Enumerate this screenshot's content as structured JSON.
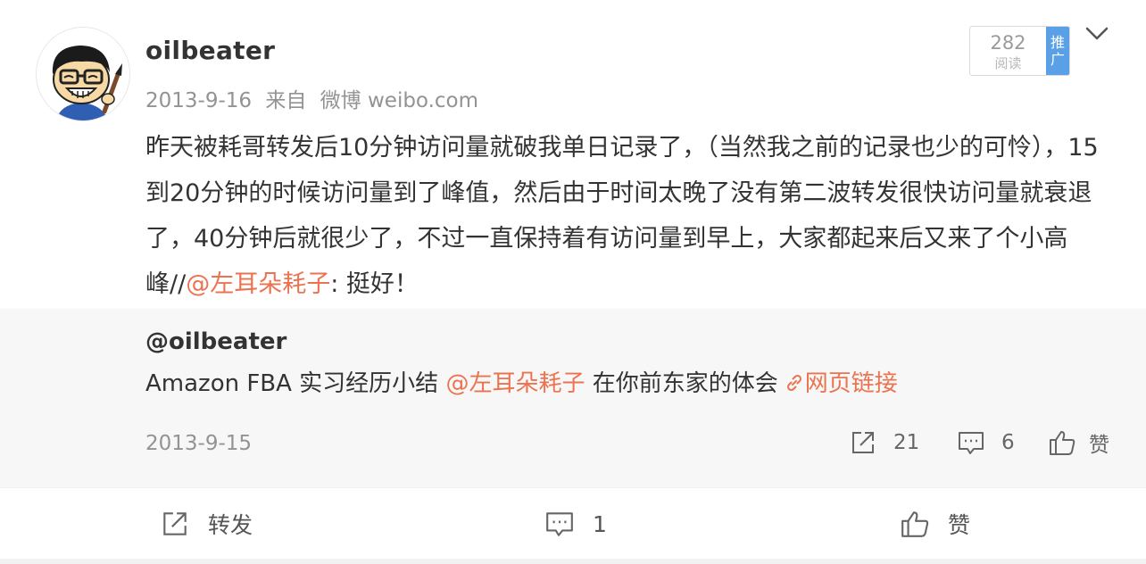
{
  "post": {
    "username": "oilbeater",
    "date": "2013-9-16",
    "source_prefix": "来自",
    "source": "微博 weibo.com",
    "text_before": "昨天被耗哥转发后10分钟访问量就破我单日记录了，（当然我之前的记录也少的可怜），15到20分钟的时候访问量到了峰值，然后由于时间太晚了没有第二波转发很快访问量就衰退了，40分钟后就很少了，不过一直保持着有访问量到早上，大家都起来后又来了个小高峰//",
    "mention": "@左耳朵耗子",
    "text_after": ": 挺好！",
    "read_count": "282",
    "read_label": "阅读",
    "promote_label": "推广"
  },
  "repost": {
    "username": "@oilbeater",
    "text_before": "Amazon FBA 实习经历小结 ",
    "mention": "@左耳朵耗子",
    "text_after": " 在你前东家的体会",
    "link_label": "网页链接",
    "date": "2013-9-15",
    "repost_count": "21",
    "comment_count": "6",
    "like_label": "赞"
  },
  "actions": {
    "repost_label": "转发",
    "comment_count": "1",
    "like_label": "赞"
  },
  "colors": {
    "accent": "#eb7350",
    "promote": "#5aa0e6",
    "meta": "#939393",
    "repost_bg": "#f7f7f7"
  },
  "icons": [
    "avatar-cartoon",
    "chevron-down-icon",
    "link-icon",
    "share-icon",
    "comment-icon",
    "thumbs-up-icon"
  ]
}
